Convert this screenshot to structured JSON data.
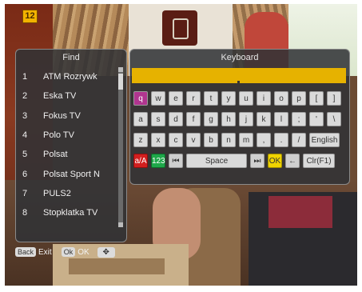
{
  "channel_badge": "12",
  "find_panel": {
    "title": "Find",
    "items": [
      {
        "num": "1",
        "name": "ATM Rozrywk"
      },
      {
        "num": "2",
        "name": "Eska TV"
      },
      {
        "num": "3",
        "name": "Fokus TV"
      },
      {
        "num": "4",
        "name": "Polo TV"
      },
      {
        "num": "5",
        "name": "Polsat"
      },
      {
        "num": "6",
        "name": "Polsat Sport N"
      },
      {
        "num": "7",
        "name": "PULS2"
      },
      {
        "num": "8",
        "name": "Stopklatka TV"
      }
    ]
  },
  "keyboard_panel": {
    "title": "Keyboard",
    "input_value": "",
    "row1": [
      "q",
      "w",
      "e",
      "r",
      "t",
      "y",
      "u",
      "i",
      "o",
      "p",
      "[",
      "]"
    ],
    "row2": [
      "a",
      "s",
      "d",
      "f",
      "g",
      "h",
      "j",
      "k",
      "l",
      ";",
      "'",
      "\\"
    ],
    "row3": [
      "z",
      "x",
      "c",
      "v",
      "b",
      "n",
      "m",
      ",",
      ".",
      "/"
    ],
    "english": "English",
    "case_toggle": "a/A",
    "num_toggle": "123",
    "prev_icon": "skip-back-icon",
    "space": "Space",
    "next_icon": "skip-forward-icon",
    "ok": "OK",
    "backspace_icon": "backspace-arrow-icon",
    "clear": "Clr(F1)"
  },
  "footer": {
    "back_button": "Back",
    "back_label": "Exit",
    "ok_button": "Ok",
    "ok_label": "OK",
    "nav_icon": "navigation-arrows-icon"
  },
  "colors": {
    "selected_key": "#b0358f",
    "red_key": "#d21f1f",
    "green_key": "#1fa84a",
    "yellow_key": "#f0d400",
    "input_bar": "#e6b200"
  }
}
